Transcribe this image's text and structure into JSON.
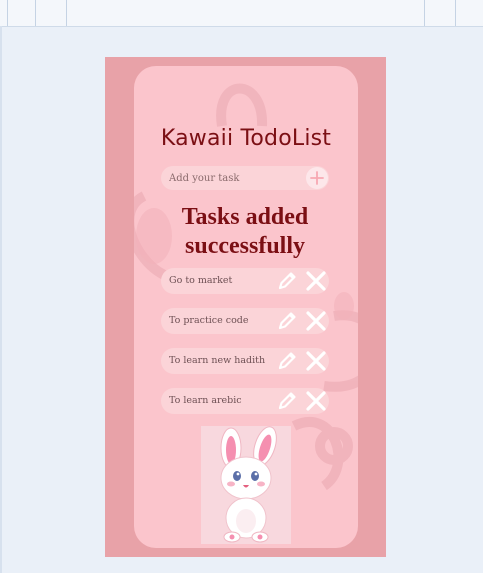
{
  "app": {
    "title": "Kawaii TodoList",
    "input": {
      "placeholder": "Add your task",
      "value": ""
    },
    "add_button_icon": "plus-icon",
    "status_message": "Tasks added successfully",
    "tasks": [
      {
        "label": "Go to market"
      },
      {
        "label": "To practice code"
      },
      {
        "label": "To learn new hadith"
      },
      {
        "label": "To learn arebic"
      }
    ],
    "task_actions": [
      "pencil-icon",
      "close-icon"
    ],
    "colors": {
      "page_background": "#eaf0f8",
      "frame": "#e8a2a8",
      "card": "#fbc5cc",
      "pill": "#fbd4d8",
      "title_text": "#7b0f14"
    }
  }
}
